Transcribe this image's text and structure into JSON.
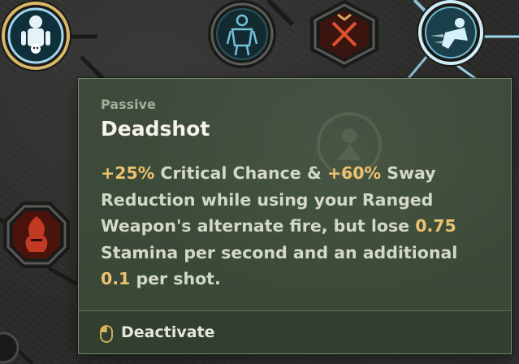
{
  "tooltip": {
    "category": "Passive",
    "title": "Deadshot",
    "description": {
      "prefix_1": "+",
      "val_1": "25%",
      "text_1": " Critical Chance & ",
      "prefix_2": "+",
      "val_2": "60%",
      "text_2": " Sway Reduction while using your Ranged Weapon's alternate fire, but lose ",
      "val_3": "0.75",
      "text_3": " Stamina per second and an additional ",
      "val_4": "0.1",
      "text_4": " per shot."
    },
    "action": {
      "icon": "mouse-icon",
      "label": "Deactivate"
    }
  },
  "colors": {
    "highlight": "#ecc270",
    "tooltip_bg": "#3c4b39",
    "text": "#d3d9c4",
    "node_active_ring": "#e9c979",
    "node_glow": "#bfe6f5",
    "node_red": "#c23a22"
  },
  "skill_nodes": [
    {
      "icon": "skull-figure-icon",
      "state": "equipped"
    },
    {
      "icon": "armored-figure-icon",
      "state": "unlocked"
    },
    {
      "icon": "crossed-swords-icon",
      "state": "unlocked"
    },
    {
      "icon": "dash-icon",
      "state": "unlocked"
    },
    {
      "icon": "fire-helm-icon",
      "state": "unlocked"
    }
  ]
}
